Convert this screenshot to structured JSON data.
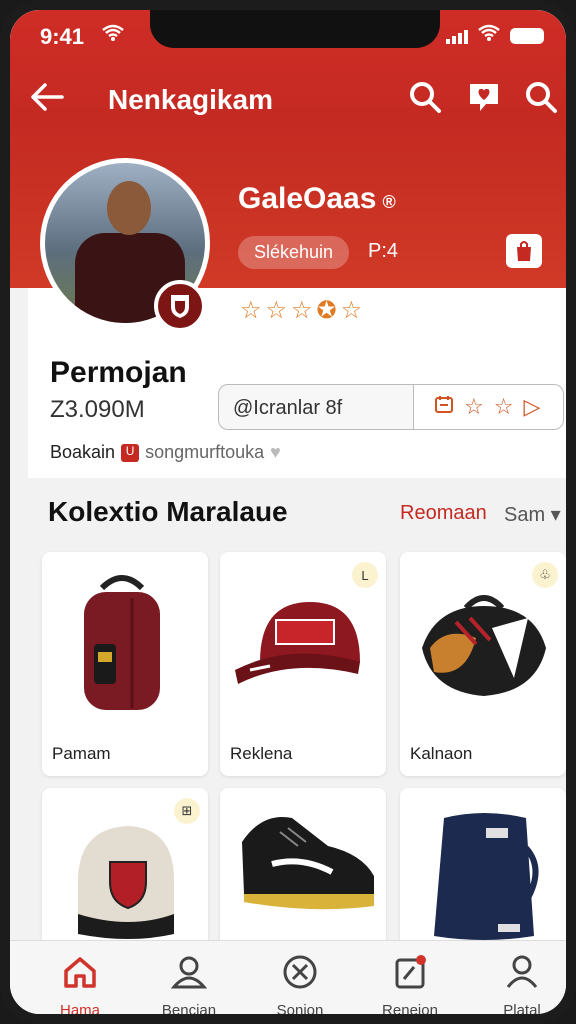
{
  "status": {
    "time": "9:41"
  },
  "appbar": {
    "title": "Nenkagikam"
  },
  "profile": {
    "shop_name": "GaleOaas",
    "verified_mark": "®",
    "pill_label": "Slékehuin",
    "pill_count": "P:4",
    "rating_stars": "☆☆☆✪☆"
  },
  "card": {
    "name": "Permojan",
    "followers": "Z3.090M",
    "search_text": "@Icranlar 8f",
    "desc_label": "Boakain",
    "desc_logo": "U",
    "desc_sub": "songmurftouka"
  },
  "section": {
    "title": "Kolextio Maralaue",
    "link": "Reomaan",
    "sort": "Sam ▾"
  },
  "products": [
    {
      "label": "Pamam",
      "icon": "backpack-icon"
    },
    {
      "label": "Reklena",
      "icon": "cap-icon",
      "corner": "L"
    },
    {
      "label": "Kalnaon",
      "icon": "bag-icon",
      "corner": "♧"
    },
    {
      "label": "",
      "icon": "backpack-icon",
      "corner": "⊞"
    },
    {
      "label": "",
      "icon": "shoe-icon"
    },
    {
      "label": "",
      "icon": "tote-icon"
    }
  ],
  "nav": [
    {
      "label": "Hama",
      "icon": "home-icon"
    },
    {
      "label": "Bencian",
      "icon": "user-icon"
    },
    {
      "label": "Sonion",
      "icon": "close-circle-icon"
    },
    {
      "label": "Reneion",
      "icon": "clipboard-icon"
    },
    {
      "label": "Platal",
      "icon": "profile-icon"
    }
  ],
  "colors": {
    "brand": "#c42a22",
    "accent": "#e07a22"
  }
}
